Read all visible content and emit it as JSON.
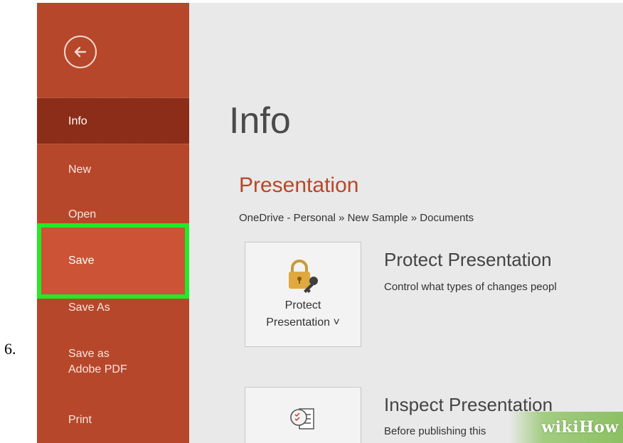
{
  "step_number": "6.",
  "sidebar": {
    "back_icon": "back-arrow-icon",
    "items": [
      {
        "label": "Info"
      },
      {
        "label": "New"
      },
      {
        "label": "Open"
      },
      {
        "label": "Save"
      },
      {
        "label": "Save As"
      },
      {
        "label": "Save as Adobe PDF"
      },
      {
        "label": "Print"
      }
    ]
  },
  "main": {
    "title": "Info",
    "section_title": "Presentation",
    "breadcrumb": "OneDrive - Personal » New Sample » Documents",
    "protect": {
      "button_line1": "Protect",
      "button_line2": "Presentation ˅",
      "icon": "lock-key-icon",
      "heading": "Protect Presentation",
      "description": "Control what types of changes peopl"
    },
    "inspect": {
      "icon": "inspect-document-icon",
      "heading": "Inspect Presentation",
      "description": "Before publishing this"
    }
  },
  "watermark": "wikiHow",
  "colors": {
    "sidebar": "#b7472a",
    "active_item": "#8c2d19",
    "save_item": "#cc5336",
    "highlight": "#22ea27",
    "accent_text": "#b7472a"
  }
}
